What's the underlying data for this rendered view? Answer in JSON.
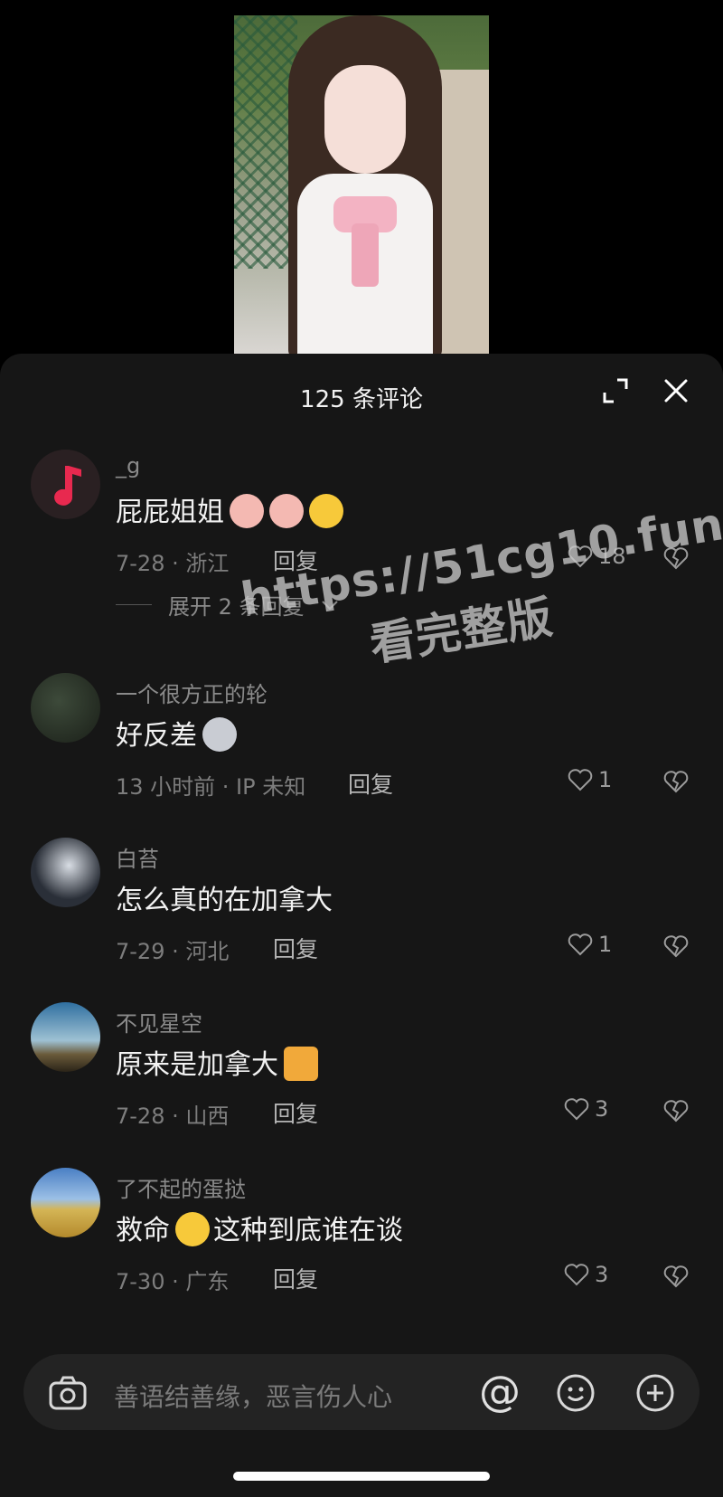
{
  "header": {
    "title": "125 条评论"
  },
  "comments": [
    {
      "name": "_g",
      "text": "屁屁姐姐",
      "emojis": [
        "pig-emoji",
        "pig-emoji",
        "love-emoji"
      ],
      "meta": "7-28 · 浙江",
      "reply": "回复",
      "likes": "18",
      "avatar": "music-note"
    },
    {
      "name": "一个很方正的轮",
      "text": "好反差",
      "emojis": [
        "husky-emoji"
      ],
      "meta": "13 小时前 · IP 未知",
      "reply": "回复",
      "likes": "1",
      "avatar": "photo"
    },
    {
      "name": "白苔",
      "text": "怎么真的在加拿大",
      "emojis": [],
      "meta": "7-29 · 河北",
      "reply": "回复",
      "likes": "1",
      "avatar": "anime"
    },
    {
      "name": "不见星空",
      "text": "原来是加拿大",
      "emojis": [
        "cat-emoji"
      ],
      "meta": "7-28 · 山西",
      "reply": "回复",
      "likes": "3",
      "avatar": "landscape"
    },
    {
      "name": "了不起的蛋挞",
      "text": "救命",
      "text2": "这种到底谁在谈",
      "emojis": [
        "crying-emoji"
      ],
      "meta": "7-30 · 广东",
      "reply": "回复",
      "likes": "3",
      "avatar": "field"
    }
  ],
  "expand_replies": "展开 2 条回复",
  "watermark": {
    "line1": "https://51cg10.fun",
    "line2": "看完整版"
  },
  "input": {
    "placeholder": "善语结善缘，恶言伤人心",
    "at_symbol": "@"
  },
  "colors": {
    "panel_bg": "#161616",
    "accent_music": "#e8294f"
  }
}
